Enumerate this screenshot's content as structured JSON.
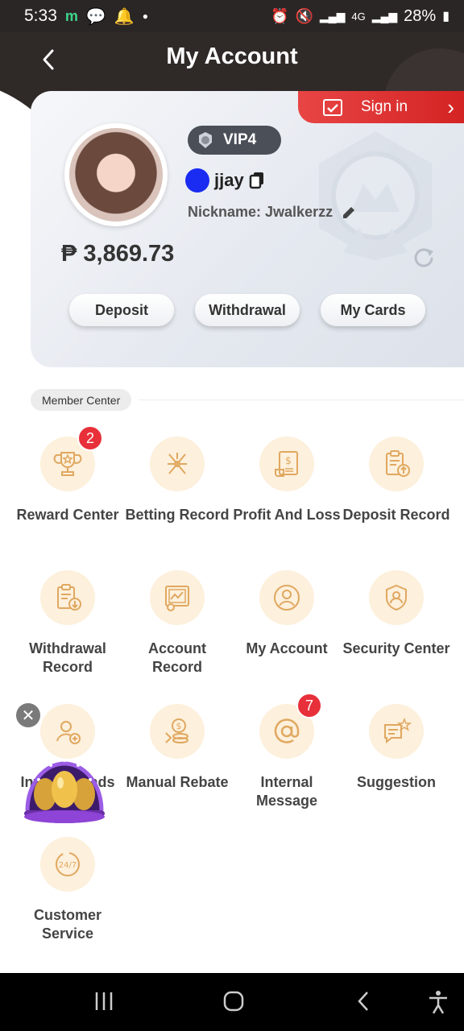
{
  "status_bar": {
    "time": "5:33",
    "app_letter": "m",
    "battery": "28%",
    "network": "4G"
  },
  "header": {
    "title": "My Account",
    "back_icon": "chevron-left-icon"
  },
  "account": {
    "sign_in_label": "Sign in",
    "vip_label": "VIP4",
    "username": "jjay",
    "nickname": "Nickname: Jwalkerzz",
    "balance": "₱ 3,869.73",
    "buttons": {
      "deposit": "Deposit",
      "withdrawal": "Withdrawal",
      "my_cards": "My Cards"
    }
  },
  "member_center": {
    "title": "Member Center",
    "items": [
      {
        "label": "Reward Center",
        "icon": "trophy-icon",
        "badge": "2"
      },
      {
        "label": "Betting Record",
        "icon": "betting-icon"
      },
      {
        "label": "Profit And Loss",
        "icon": "receipt-icon"
      },
      {
        "label": "Deposit Record",
        "icon": "clipboard-upload-icon"
      },
      {
        "label": "Withdrawal Record",
        "icon": "clipboard-download-icon"
      },
      {
        "label": "Account Record",
        "icon": "monitor-chart-icon"
      },
      {
        "label": "My Account",
        "icon": "user-circle-icon"
      },
      {
        "label": "Security Center",
        "icon": "shield-user-icon"
      },
      {
        "label": "Invite Friends",
        "icon": "user-add-icon"
      },
      {
        "label": "Manual Rebate",
        "icon": "coins-icon"
      },
      {
        "label": "Internal Message",
        "icon": "at-icon",
        "badge": "7"
      },
      {
        "label": "Suggestion",
        "icon": "chat-star-icon"
      },
      {
        "label": "Customer Service",
        "icon": "support-247-icon"
      }
    ]
  },
  "colors": {
    "header_bg": "#2f2927",
    "accent_red": "#e8303a",
    "icon_bg": "#fdf0dc",
    "icon_stroke": "#e0a860"
  }
}
